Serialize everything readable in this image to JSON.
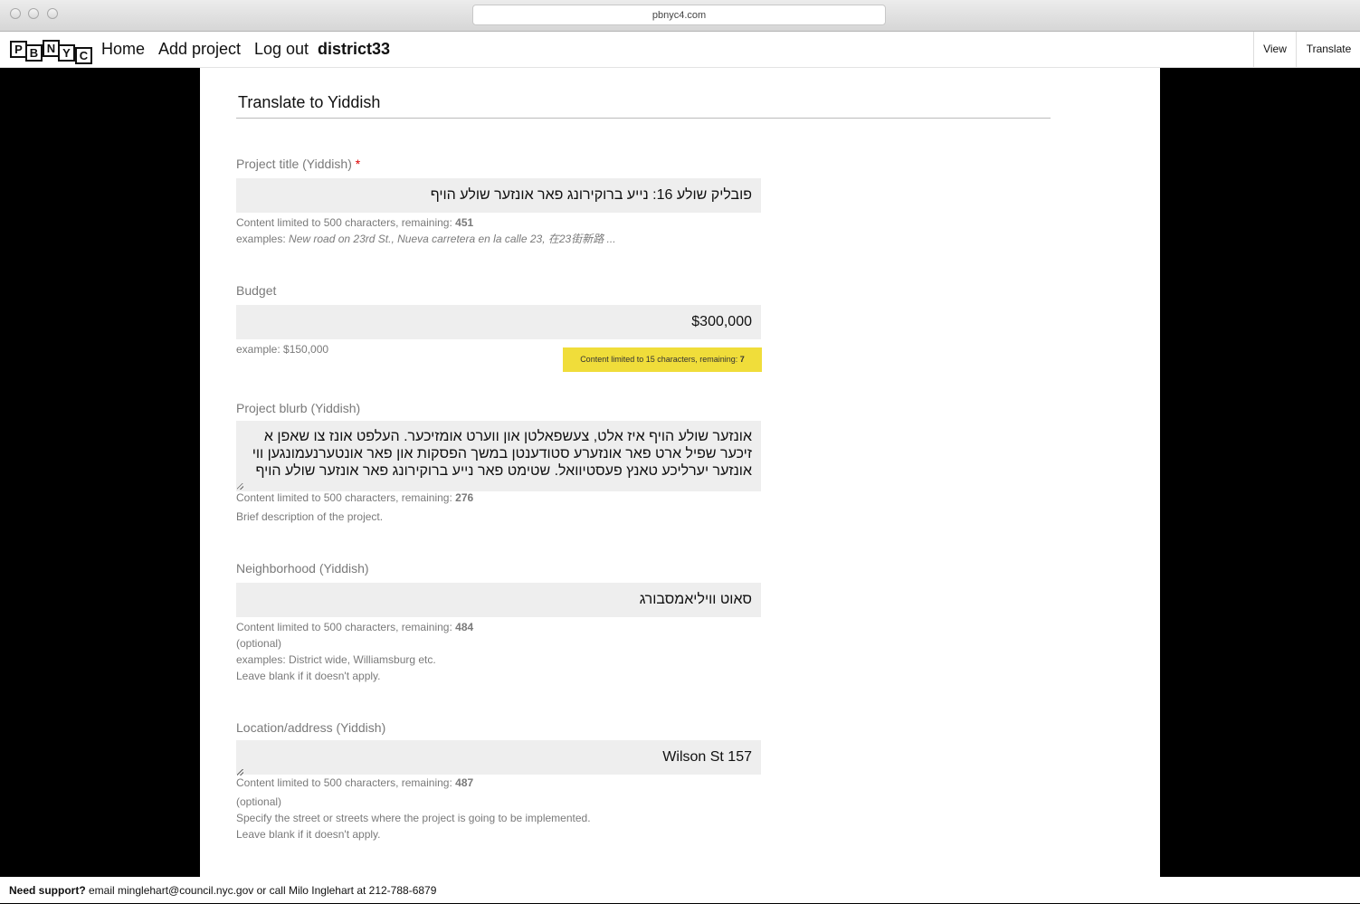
{
  "browser": {
    "url": "pbnyc4.com"
  },
  "nav": {
    "logo_letters": [
      "P",
      "B",
      "N",
      "Y",
      "C"
    ],
    "home": "Home",
    "add_project": "Add project",
    "log_out": "Log out",
    "user": "district33",
    "view": "View",
    "translate": "Translate"
  },
  "page": {
    "heading": "Translate to Yiddish"
  },
  "form": {
    "title": {
      "label": "Project title (Yiddish)",
      "required_mark": "*",
      "value": "פובליק שולע 16: נייע ברוקירונג פאר אונזער שולע הויף",
      "limit_prefix": "Content limited to 500 characters, remaining:",
      "remaining": "451",
      "examples_prefix": "examples:",
      "examples": "New road on 23rd St., Nueva carretera en la calle 23, 在23街新路 ..."
    },
    "budget": {
      "label": "Budget",
      "value": "$300,000",
      "example": "example: $150,000",
      "tooltip_prefix": "Content limited to 15 characters, remaining:",
      "tooltip_remaining": "7"
    },
    "blurb": {
      "label": "Project blurb (Yiddish)",
      "value": "אונזער שולע הויף איז אלט, צעשפאלטן און ווערט אומזיכער.   העלפט אונז צו שאפן א זיכער שפיל ארט פאר אונזערע סטודענטן במשך הפסקות און פאר אונטערנעמונגען ווי אונזער יערליכע טאנץ פעסטיוואל.  שטימט פאר נייע ברוקירונג פאר אונזער שולע הויף",
      "limit_prefix": "Content limited to 500 characters, remaining:",
      "remaining": "276",
      "description": "Brief description of the project."
    },
    "neighborhood": {
      "label": "Neighborhood (Yiddish)",
      "value": "סאוט וויליאמסבורג",
      "limit_prefix": "Content limited to 500 characters, remaining:",
      "remaining": "484",
      "optional": "(optional)",
      "examples": "examples: District wide, Williamsburg etc.",
      "blank": "Leave blank if it doesn't apply."
    },
    "location": {
      "label": "Location/address (Yiddish)",
      "value": "Wilson St 157",
      "limit_prefix": "Content limited to 500 characters, remaining:",
      "remaining": "487",
      "optional": "(optional)",
      "specify": "Specify the street or streets where the project is going to be implemented.",
      "blank": "Leave blank if it doesn't apply."
    }
  },
  "footer": {
    "bold": "Need support?",
    "text": " email minglehart@council.nyc.gov or call Milo Inglehart at 212-788-6879"
  }
}
